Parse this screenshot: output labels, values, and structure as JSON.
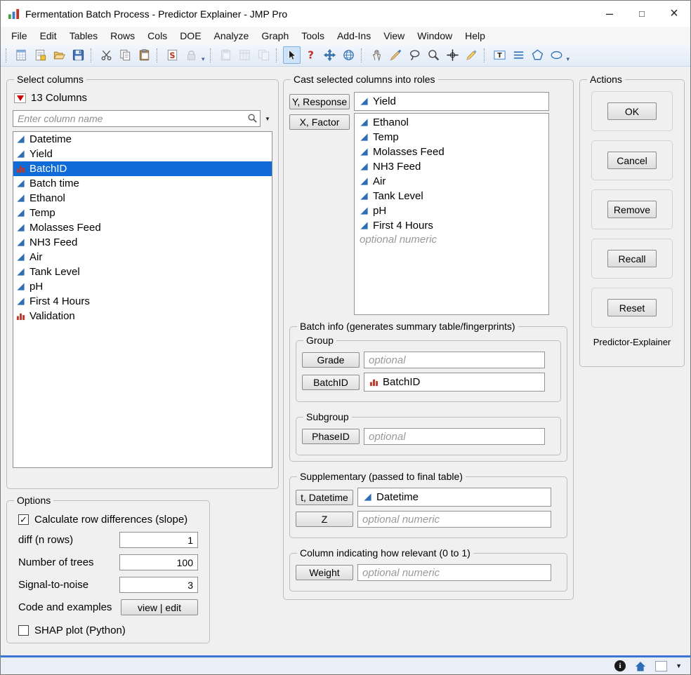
{
  "window": {
    "title": "Fermentation Batch Process - Predictor Explainer - JMP Pro",
    "minimize": "–",
    "maximize": "□",
    "close": "×"
  },
  "menu": {
    "items": [
      "File",
      "Edit",
      "Tables",
      "Rows",
      "Cols",
      "DOE",
      "Analyze",
      "Graph",
      "Tools",
      "Add-Ins",
      "View",
      "Window",
      "Help"
    ]
  },
  "toolbar": {
    "groups": [
      {
        "icons": [
          "new-data-table-icon",
          "new-journal-icon",
          "open-icon",
          "save-icon"
        ]
      },
      {
        "icons": [
          "cut-icon",
          "copy-icon",
          "paste-icon"
        ]
      },
      {
        "icons": [
          "run-script-icon",
          "lock-icon"
        ],
        "overflow": true
      },
      {
        "icons": [
          "paste-special-icon",
          "copy-with-names-icon",
          "duplicate-table-icon"
        ]
      },
      {
        "icons": [
          "arrow-tool-icon",
          "help-tool-icon",
          "move-tool-icon",
          "globe-tool-icon"
        ]
      },
      {
        "icons": [
          "grabber-tool-icon",
          "brush-tool-icon",
          "lasso-tool-icon",
          "magnifier-tool-icon",
          "crosshair-tool-icon",
          "annotate-tool-icon"
        ]
      },
      {
        "icons": [
          "text-box-tool-icon",
          "line-tool-icon",
          "polygon-tool-icon",
          "oval-tool-icon"
        ],
        "overflow": true
      }
    ],
    "selected_tool": "arrow-tool-icon",
    "disabled_icons": [
      "lock-icon",
      "paste-special-icon",
      "copy-with-names-icon",
      "duplicate-table-icon"
    ]
  },
  "select_columns": {
    "legend": "Select columns",
    "columns_count": "13 Columns",
    "search_placeholder": "Enter column name",
    "items": [
      {
        "name": "Datetime",
        "type": "continuous"
      },
      {
        "name": "Yield",
        "type": "continuous"
      },
      {
        "name": "BatchID",
        "type": "nominal",
        "selected": true
      },
      {
        "name": "Batch time",
        "type": "continuous"
      },
      {
        "name": "Ethanol",
        "type": "continuous"
      },
      {
        "name": "Temp",
        "type": "continuous"
      },
      {
        "name": "Molasses Feed",
        "type": "continuous"
      },
      {
        "name": "NH3 Feed",
        "type": "continuous"
      },
      {
        "name": "Air",
        "type": "continuous"
      },
      {
        "name": "Tank Level",
        "type": "continuous"
      },
      {
        "name": "pH",
        "type": "continuous"
      },
      {
        "name": "First 4 Hours",
        "type": "continuous"
      },
      {
        "name": "Validation",
        "type": "nominal"
      }
    ]
  },
  "options": {
    "legend": "Options",
    "row_diff_label": "Calculate row differences (slope)",
    "row_diff_checked": true,
    "diff_label": "diff (n rows)",
    "diff_value": "1",
    "trees_label": "Number of trees",
    "trees_value": "100",
    "snr_label": "Signal-to-noise",
    "snr_value": "3",
    "code_label": "Code and examples",
    "code_button_label": "view | edit",
    "shap_label": "SHAP plot (Python)",
    "shap_checked": false
  },
  "cast": {
    "legend": "Cast selected columns into roles",
    "y_button": "Y, Response",
    "y_items": [
      {
        "name": "Yield",
        "type": "continuous"
      }
    ],
    "x_button": "X, Factor",
    "x_items": [
      {
        "name": "Ethanol",
        "type": "continuous"
      },
      {
        "name": "Temp",
        "type": "continuous"
      },
      {
        "name": "Molasses Feed",
        "type": "continuous"
      },
      {
        "name": "NH3 Feed",
        "type": "continuous"
      },
      {
        "name": "Air",
        "type": "continuous"
      },
      {
        "name": "Tank Level",
        "type": "continuous"
      },
      {
        "name": "pH",
        "type": "continuous"
      },
      {
        "name": "First 4 Hours",
        "type": "continuous"
      }
    ],
    "x_placeholder": "optional numeric",
    "batch_info_legend": "Batch info (generates summary table/fingerprints)",
    "group_legend": "Group",
    "grade_button": "Grade",
    "grade_placeholder": "optional",
    "batchid_button": "BatchID",
    "batchid_items": [
      {
        "name": "BatchID",
        "type": "nominal"
      }
    ],
    "subgroup_legend": "Subgroup",
    "phaseid_button": "PhaseID",
    "phaseid_placeholder": "optional",
    "supplementary_legend": "Supplementary (passed to final table)",
    "datetime_button": "t, Datetime",
    "datetime_items": [
      {
        "name": "Datetime",
        "type": "continuous"
      }
    ],
    "z_button": "Z",
    "z_placeholder": "optional numeric",
    "weight_legend": "Column indicating how relevant (0 to 1)",
    "weight_button": "Weight",
    "weight_placeholder": "optional numeric"
  },
  "actions": {
    "legend": "Actions",
    "buttons": [
      "OK",
      "Cancel",
      "Remove",
      "Recall",
      "Reset"
    ],
    "caption": "Predictor-Explainer"
  },
  "status": {
    "icons": [
      "info-icon",
      "home-icon",
      "window-preview-icon",
      "chevron-down-icon"
    ]
  },
  "colors": {
    "selection": "#0f6bd7",
    "continuous_icon": "#2f6db5",
    "nominal_icon": "#c0392b",
    "statusbar_accent": "#3a76d6"
  }
}
